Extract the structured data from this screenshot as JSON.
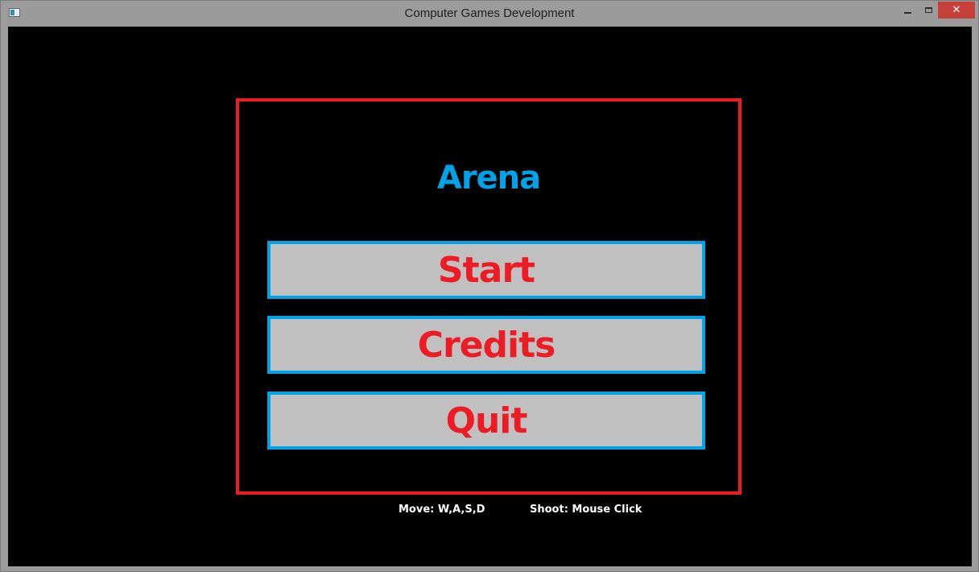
{
  "window": {
    "title": "Computer Games Development",
    "close_glyph": "✕",
    "icons": [
      "app-icon",
      "minimize-icon",
      "maximize-icon",
      "close-icon"
    ]
  },
  "game": {
    "title": "Arena",
    "menu": {
      "start_label": "Start",
      "credits_label": "Credits",
      "quit_label": "Quit"
    },
    "hints": {
      "move": "Move: W,A,S,D",
      "shoot": "Shoot: Mouse Click"
    }
  },
  "colors": {
    "background": "#000000",
    "frame_border": "#ed1c24",
    "title_text": "#00a2e8",
    "button_fill": "#c0c0c0",
    "button_border": "#00a2e8",
    "button_text": "#ed1c24",
    "hint_text": "#ffffff",
    "close_button": "#c7403a"
  }
}
